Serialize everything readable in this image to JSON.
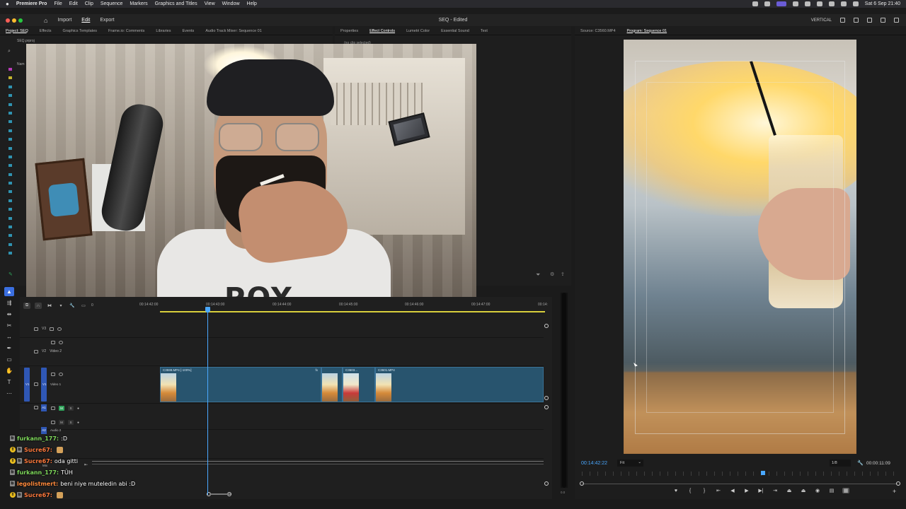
{
  "menubar": {
    "app_name": "Premiere Pro",
    "items": [
      "File",
      "Edit",
      "Clip",
      "Sequence",
      "Markers",
      "Graphics and Titles",
      "View",
      "Window",
      "Help"
    ],
    "clock": "Sat 6 Sep  21:40"
  },
  "titlebar": {
    "workspaces": [
      "Import",
      "Edit",
      "Export"
    ],
    "active_workspace": "Edit",
    "document_title": "SEQ - Edited",
    "layout_label": "VERTICAL"
  },
  "project_panel": {
    "tabs": [
      "Project: SEQ",
      "Effects",
      "Graphics Templates",
      "Frame.io: Comments",
      "Libraries",
      "Events",
      "Audio Track Mixer: Sequence 01"
    ],
    "active_tab": "Project: SEQ",
    "file": "SEQ.prproj",
    "column_partial": "Nam"
  },
  "effect_panel": {
    "tabs": [
      "Properties",
      "Effect Controls",
      "Lumetri Color",
      "Essential Sound",
      "Text"
    ],
    "active_tab": "Effect Controls",
    "message_partial": "(no clip selected)"
  },
  "source_panel": {
    "tabs": [
      "Source: C3560.MP4",
      "Program: Sequence 01"
    ],
    "active_tab": "Program: Sequence 01"
  },
  "timeline": {
    "start_tc": "0",
    "ruler": [
      "00:14:42:00",
      "00:14:43:00",
      "00:14:44:00",
      "00:14:45:00",
      "00:14:46:00",
      "00:14:47:00",
      "00:14:"
    ],
    "tracks": {
      "v3": "V3",
      "v2": "V2",
      "v2_name": "Video 2",
      "v1_src": "V1",
      "v1": "V1",
      "v1_name": "Video 1",
      "a1_src": "A1",
      "a1": "A1",
      "a2": "A2",
      "a2_name": "Audio 2",
      "mix": "Mix",
      "mix_value": "0.0"
    },
    "clips": [
      {
        "label": "C3599.MP4 [-100%]",
        "fx": "fx"
      },
      {
        "label": "C3603...",
        "fx": ""
      },
      {
        "label": "C3601.MP4",
        "fx": ""
      }
    ]
  },
  "chat": [
    {
      "badges": "b",
      "user": "furkann_177:",
      "user_color": "#7fd85c",
      "msg": ":D",
      "emote": false
    },
    {
      "badges": "!b",
      "user": "Sucre67:",
      "user_color": "#ff7a3d",
      "msg": "",
      "emote": true
    },
    {
      "badges": "!b",
      "user": "Sucre67:",
      "user_color": "#ff7a3d",
      "msg": "oda gitti",
      "emote": false
    },
    {
      "badges": "b",
      "user": "furkann_177:",
      "user_color": "#7fd85c",
      "msg": "TÜH",
      "emote": false
    },
    {
      "badges": "b",
      "user": "legolistmert:",
      "user_color": "#ff8a3d",
      "msg": "beni niye muteledin abi :D",
      "emote": false
    },
    {
      "badges": "!b",
      "user": "Sucre67:",
      "user_color": "#ff7a3d",
      "msg": "",
      "emote": true
    }
  ],
  "program": {
    "timecode": "00:14:42:22",
    "fit": "Fit",
    "resolution": "1/8",
    "duration": "00:00:11:09"
  }
}
